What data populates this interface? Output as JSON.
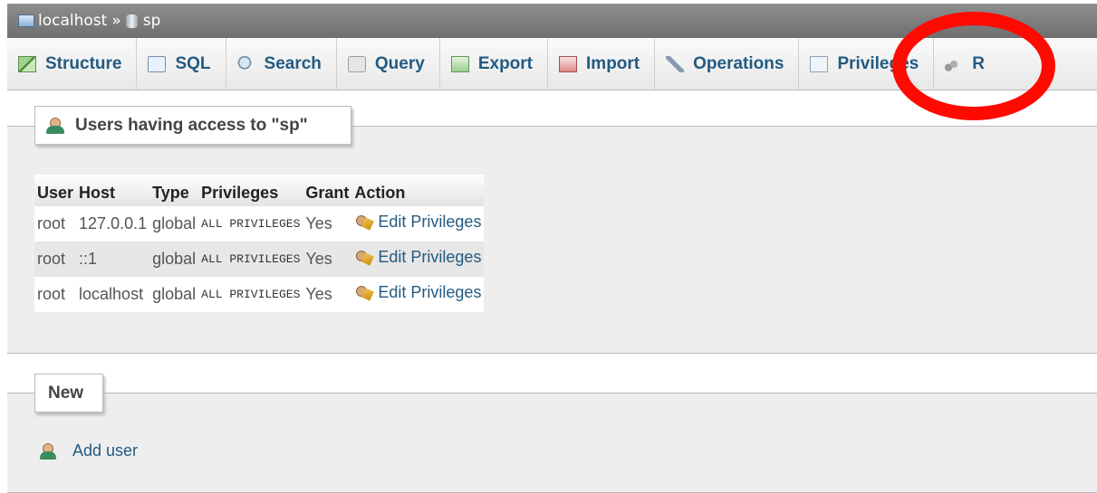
{
  "breadcrumb": {
    "server": "localhost",
    "separator": "»",
    "database": "sp"
  },
  "tabs": [
    {
      "label": "Structure",
      "icon": "structure-icon"
    },
    {
      "label": "SQL",
      "icon": "sql-icon"
    },
    {
      "label": "Search",
      "icon": "search-icon"
    },
    {
      "label": "Query",
      "icon": "query-icon"
    },
    {
      "label": "Export",
      "icon": "export-icon"
    },
    {
      "label": "Import",
      "icon": "import-icon"
    },
    {
      "label": "Operations",
      "icon": "operations-icon"
    },
    {
      "label": "Privileges",
      "icon": "privileges-icon"
    },
    {
      "label": "R",
      "icon": "routines-icon"
    }
  ],
  "users_section": {
    "legend": "Users having access to \"sp\"",
    "columns": [
      "User",
      "Host",
      "Type",
      "Privileges",
      "Grant",
      "Action"
    ],
    "rows": [
      {
        "user": "root",
        "host": "127.0.0.1",
        "type": "global",
        "privileges": "ALL PRIVILEGES",
        "grant": "Yes",
        "action": "Edit Privileges"
      },
      {
        "user": "root",
        "host": "::1",
        "type": "global",
        "privileges": "ALL PRIVILEGES",
        "grant": "Yes",
        "action": "Edit Privileges"
      },
      {
        "user": "root",
        "host": "localhost",
        "type": "global",
        "privileges": "ALL PRIVILEGES",
        "grant": "Yes",
        "action": "Edit Privileges"
      }
    ]
  },
  "new_section": {
    "legend": "New",
    "add_user_label": "Add user"
  },
  "colors": {
    "annotation_ring": "#ff0a00",
    "link": "#235a81",
    "breadcrumb_bg": "#7f7f7f"
  }
}
